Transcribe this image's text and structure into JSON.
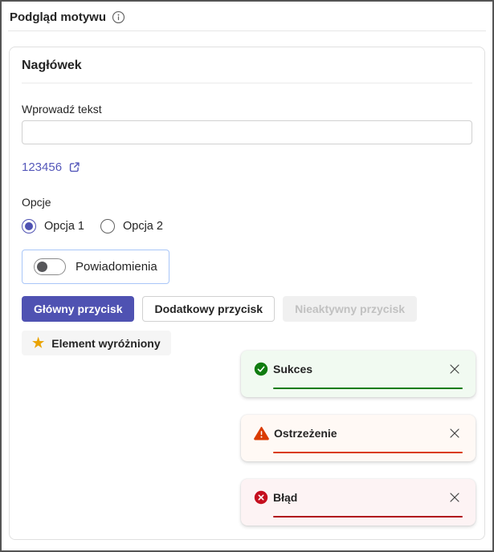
{
  "header": {
    "title": "Podgląd motywu"
  },
  "colors": {
    "brand": "#4f52b2",
    "link": "#5558ba",
    "star": "#eaa300",
    "toggle_box_border": "#a9c6f8"
  },
  "preview": {
    "heading": "Nagłówek",
    "text_field": {
      "label": "Wprowadź tekst",
      "value": "",
      "placeholder": ""
    },
    "link": {
      "label": "123456"
    },
    "options": {
      "label": "Opcje",
      "items": [
        {
          "label": "Opcja 1",
          "selected": true
        },
        {
          "label": "Opcja 2",
          "selected": false
        }
      ]
    },
    "toggle": {
      "label": "Powiadomienia",
      "state": "off"
    },
    "buttons": {
      "primary": "Główny przycisk",
      "secondary": "Dodatkowy przycisk",
      "disabled": "Nieaktywny przycisk"
    },
    "featured": {
      "label": "Element wyróżniony"
    },
    "toasts": [
      {
        "type": "success",
        "title": "Sukces",
        "bg": "#f1faf1",
        "icon_color": "#107c10",
        "accent": "#107c10"
      },
      {
        "type": "warning",
        "title": "Ostrzeżenie",
        "bg": "#fff9f5",
        "icon_color": "#da3b01",
        "accent": "#da3b01"
      },
      {
        "type": "error",
        "title": "Błąd",
        "bg": "#fdf3f4",
        "icon_color": "#c50f1f",
        "accent": "#b10e1c"
      }
    ]
  }
}
